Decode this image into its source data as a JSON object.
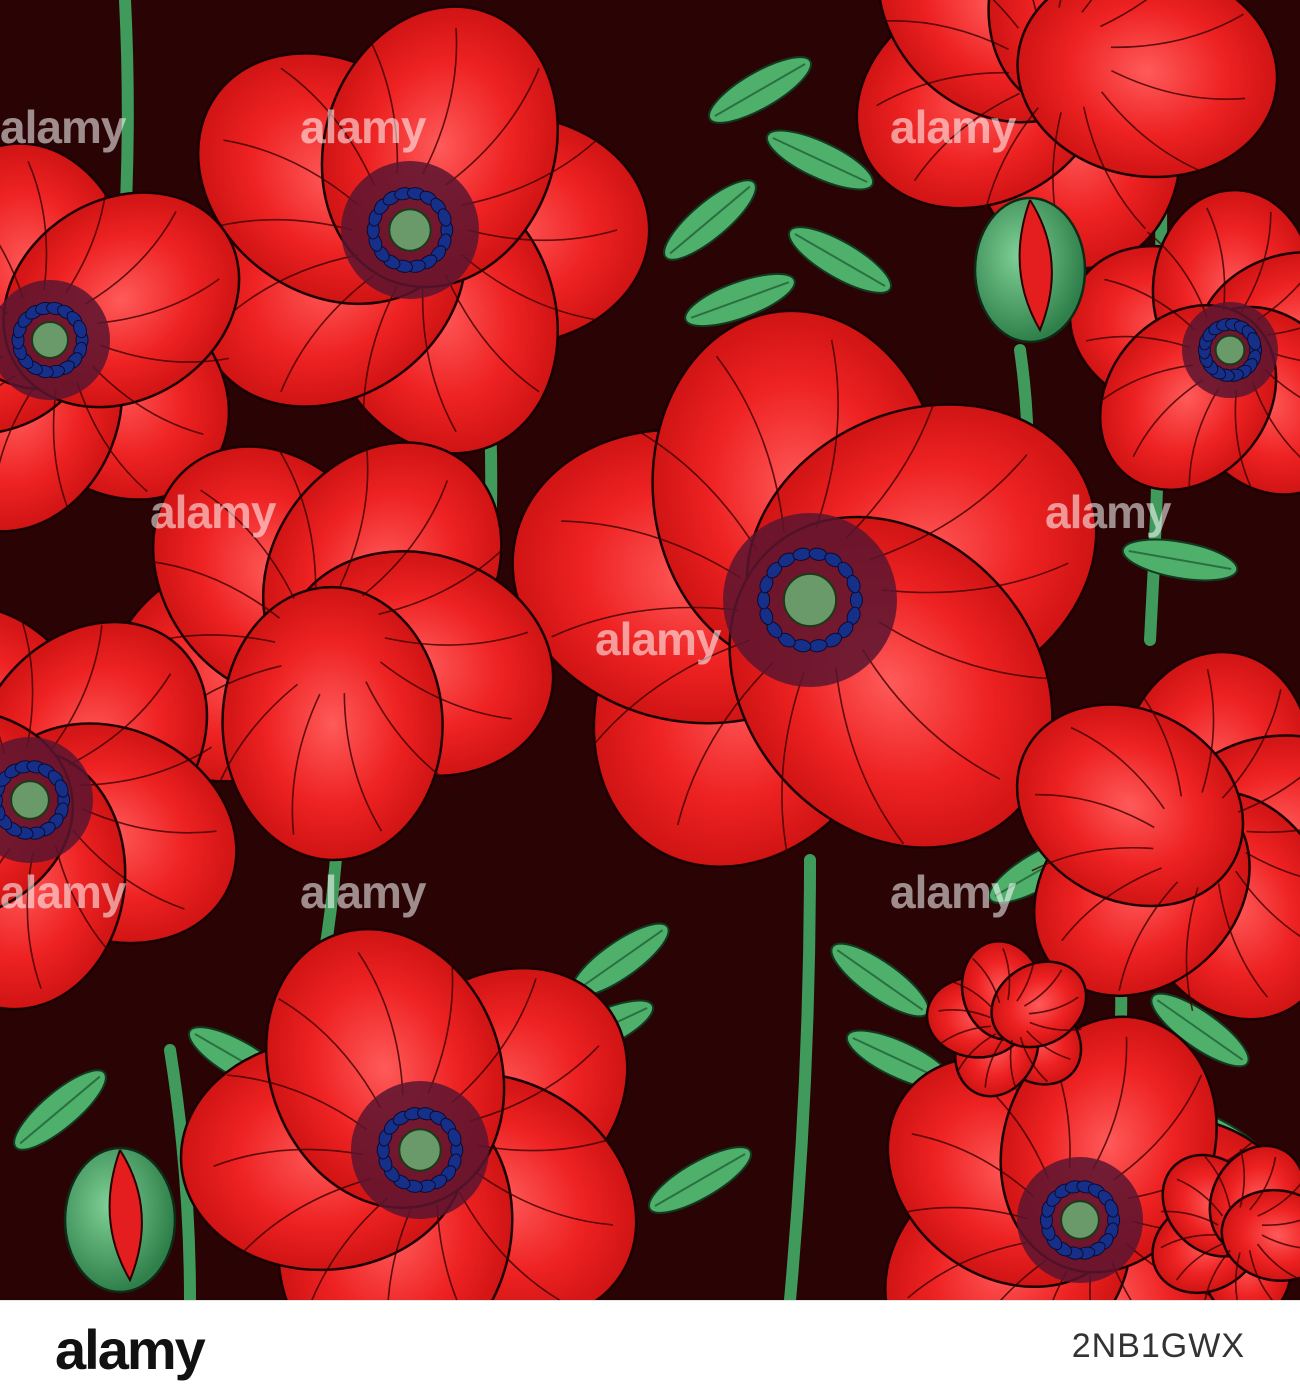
{
  "image": {
    "subject": "",
    "background_color": "#2a0404",
    "petal_colors": [
      "#e8191a",
      "#ff4a4a",
      "#c40f10"
    ],
    "center_colors": [
      "#5a1530",
      "#16308a",
      "#6a9a6a"
    ],
    "leaf_colors": [
      "#3f9a5b",
      "#6fc58a",
      "#2f7a48"
    ]
  },
  "watermark": {
    "text": "alamy"
  },
  "footer": {
    "logo_text": "alamy",
    "image_id": "2NB1GWX",
    "background": "#ffffff"
  }
}
